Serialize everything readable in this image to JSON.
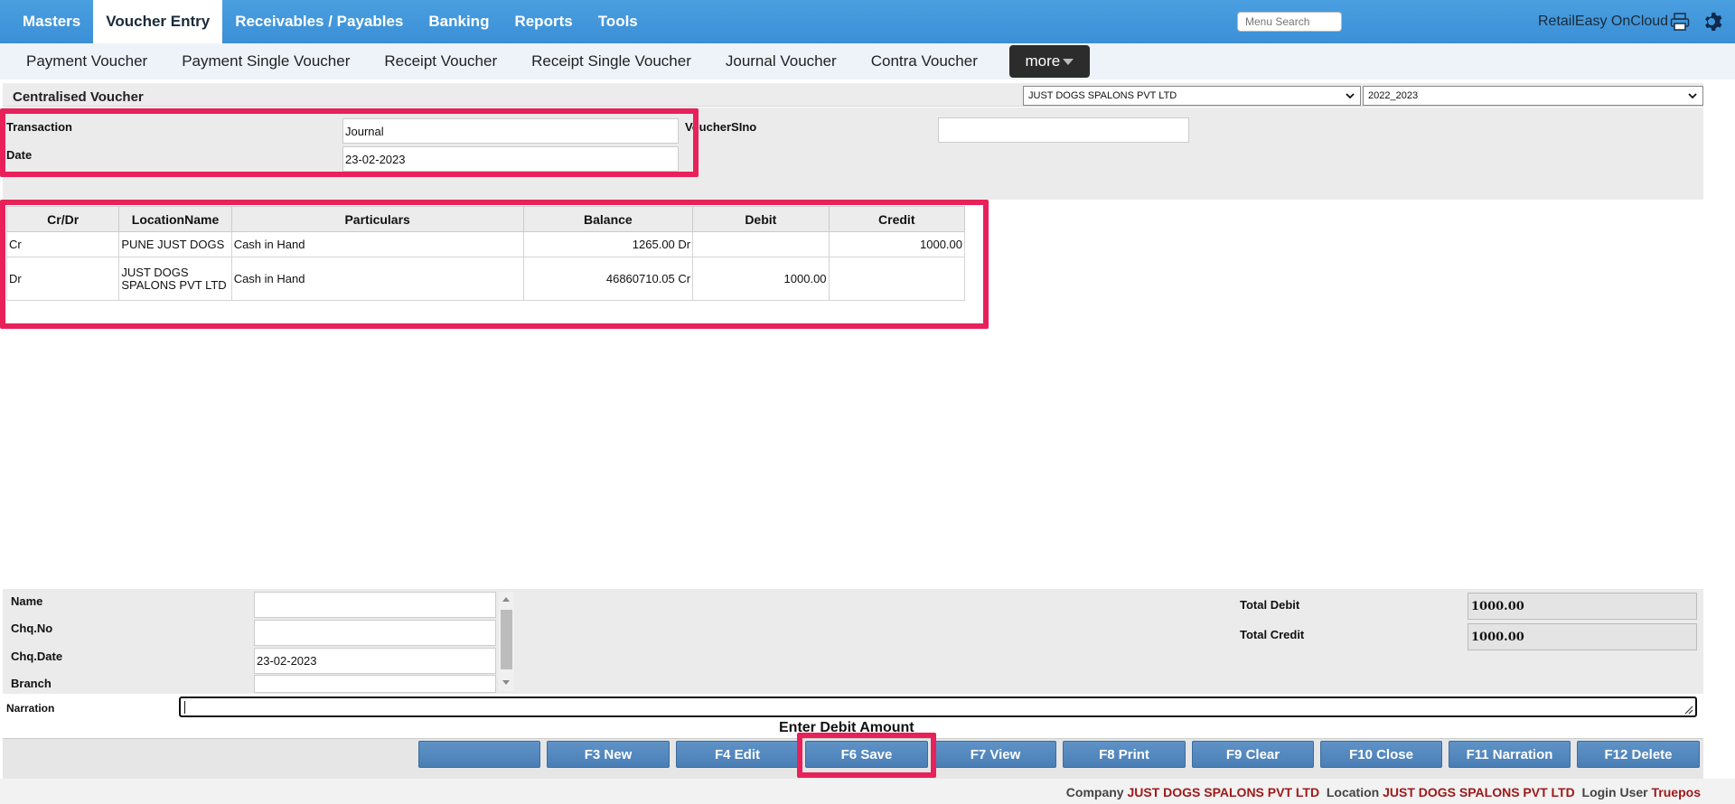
{
  "topnav": {
    "tabs": [
      "Masters",
      "Voucher Entry",
      "Receivables / Payables",
      "Banking",
      "Reports",
      "Tools"
    ],
    "active_tab": "Voucher Entry",
    "menu_search_placeholder": "Menu Search",
    "brand": "RetailEasy OnCloud",
    "icons": [
      "print-icon",
      "gear-icon"
    ]
  },
  "subnav": {
    "items": [
      "Payment Voucher",
      "Payment Single Voucher",
      "Receipt Voucher",
      "Receipt Single Voucher",
      "Journal Voucher",
      "Contra Voucher"
    ],
    "more_label": "more"
  },
  "page": {
    "title": "Centralised Voucher",
    "company_select": "JUST DOGS SPALONS PVT LTD",
    "year_select": "2022_2023"
  },
  "header_form": {
    "transaction_label": "Transaction",
    "transaction_value": "Journal",
    "date_label": "Date",
    "date_value": "23-02-2023",
    "voucher_sino_label": "VoucherSIno",
    "voucher_sino_value": ""
  },
  "grid": {
    "columns": [
      "Cr/Dr",
      "LocationName",
      "Particulars",
      "Balance",
      "Debit",
      "Credit"
    ],
    "rows": [
      {
        "crdr": "Cr",
        "location": "PUNE JUST DOGS",
        "particulars": "Cash in Hand",
        "balance": "1265.00 Dr",
        "debit": "",
        "credit": "1000.00"
      },
      {
        "crdr": "Dr",
        "location": "JUST DOGS SPALONS PVT LTD",
        "particulars": "Cash in Hand",
        "balance": "46860710.05 Cr",
        "debit": "1000.00",
        "credit": ""
      }
    ]
  },
  "bottom_form": {
    "name_label": "Name",
    "name_value": "",
    "chqno_label": "Chq.No",
    "chqno_value": "",
    "chqdate_label": "Chq.Date",
    "chqdate_value": "23-02-2023",
    "branch_label": "Branch",
    "branch_value": "",
    "total_debit_label": "Total Debit",
    "total_debit_value": "1000.00",
    "total_credit_label": "Total Credit",
    "total_credit_value": "1000.00",
    "narration_label": "Narration",
    "narration_value": ""
  },
  "status_message": "Enter Debit Amount",
  "buttons": [
    "",
    "F3 New",
    "F4 Edit",
    "F6 Save",
    "F7 View",
    "F8 Print",
    "F9 Clear",
    "F10 Close",
    "F11 Narration",
    "F12 Delete"
  ],
  "footer": {
    "company_label": "Company",
    "company_value": "JUST DOGS SPALONS PVT LTD",
    "location_label": "Location",
    "location_value": "JUST DOGS SPALONS PVT LTD",
    "login_label": "Login User",
    "login_value": "Truepos"
  },
  "colors": {
    "nav_blue": "#3b8fd6",
    "highlight": "#e8215a",
    "button_blue": "#4a7fb6",
    "footer_value": "#a01818"
  }
}
